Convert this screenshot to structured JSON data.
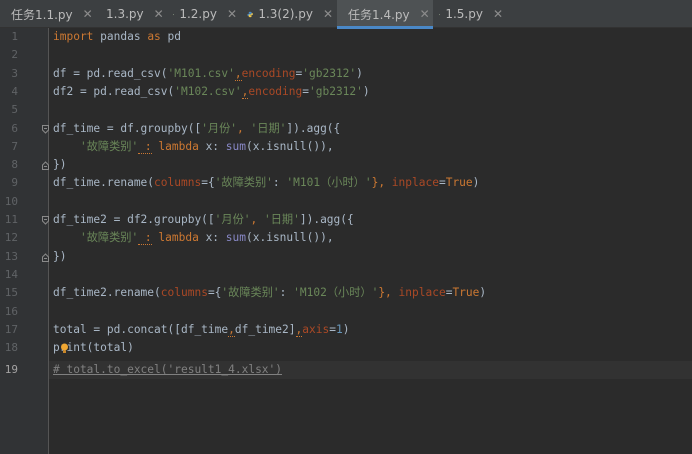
{
  "tabs": [
    {
      "label": "任务1.1.py",
      "active": false
    },
    {
      "label": "1.3.py",
      "active": false
    },
    {
      "label": "1.2.py",
      "active": false
    },
    {
      "label": "1.3(2).py",
      "active": false
    },
    {
      "label": "任务1.4.py",
      "active": true
    },
    {
      "label": "1.5.py",
      "active": false
    }
  ],
  "close_glyph": "✕",
  "line_numbers": [
    "1",
    "2",
    "3",
    "4",
    "5",
    "6",
    "7",
    "8",
    "9",
    "10",
    "11",
    "12",
    "13",
    "14",
    "15",
    "16",
    "17",
    "18",
    "19"
  ],
  "current_line": 19,
  "code": {
    "l1_import": "import",
    "l1_mid": " pandas ",
    "l1_as": "as",
    "l1_end": " pd",
    "l3_a": "df = pd.read_csv(",
    "l3_str1": "'M101.csv'",
    "l3_comma": ",",
    "l3_kw": "encoding",
    "l3_eq": "=",
    "l3_str2": "'gb2312'",
    "l3_end": ")",
    "l4_a": "df2 = pd.read_csv(",
    "l4_str1": "'M102.csv'",
    "l4_comma": ",",
    "l4_kw": "encoding",
    "l4_eq": "=",
    "l4_str2": "'gb2312'",
    "l4_end": ")",
    "l6_a": "df_time = df.groupby([",
    "l6_s1": "'月份'",
    "l6_c": ", ",
    "l6_s2": "'日期'",
    "l6_end": "]).agg({",
    "l7_indent": "    ",
    "l7_s": "'故障类别'",
    "l7_colon": " :",
    "l7_lambda": " lambda",
    "l7_x": " x: ",
    "l7_sum": "sum",
    "l7_end": "(x.isnull()),",
    "l8": "})",
    "l9_a": "df_time.rename(",
    "l9_kw": "columns",
    "l9_b": "={",
    "l9_s1": "'故障类别'",
    "l9_c": ": ",
    "l9_s2": "'M101（小时）'",
    "l9_d": "}, ",
    "l9_kw2": "inplace",
    "l9_eq": "=",
    "l9_true": "True",
    "l9_end": ")",
    "l11_a": "df_time2 = df2.groupby([",
    "l11_s1": "'月份'",
    "l11_c": ", ",
    "l11_s2": "'日期'",
    "l11_end": "]).agg({",
    "l12_indent": "    ",
    "l12_s": "'故障类别'",
    "l12_colon": " :",
    "l12_lambda": " lambda",
    "l12_x": " x: ",
    "l12_sum": "sum",
    "l12_end": "(x.isnull()),",
    "l13": "})",
    "l15_a": "df_time2.rename(",
    "l15_kw": "columns",
    "l15_b": "={",
    "l15_s1": "'故障类别'",
    "l15_c": ": ",
    "l15_s2": "'M102（小时）'",
    "l15_d": "}, ",
    "l15_kw2": "inplace",
    "l15_eq": "=",
    "l15_true": "True",
    "l15_end": ")",
    "l17_a": "total = pd.concat([df_time",
    "l17_comma1": ",",
    "l17_b": "df_time2]",
    "l17_comma2": ",",
    "l17_kw": "axis",
    "l17_eq": "=",
    "l17_num": "1",
    "l17_end": ")",
    "l18": "print(total)",
    "l19": "# total.to_excel('result1_4.xlsx')"
  },
  "colors": {
    "editor_bg": "#2b2b2b",
    "gutter_bg": "#313335",
    "tabbar_bg": "#3c3f41",
    "active_tab_underline": "#4a88c7",
    "keyword": "#cc7832",
    "string": "#6a8759",
    "number": "#6897bb",
    "kwarg": "#aa4926",
    "builtin": "#8888c6",
    "comment": "#808080",
    "text": "#a9b7c6"
  }
}
